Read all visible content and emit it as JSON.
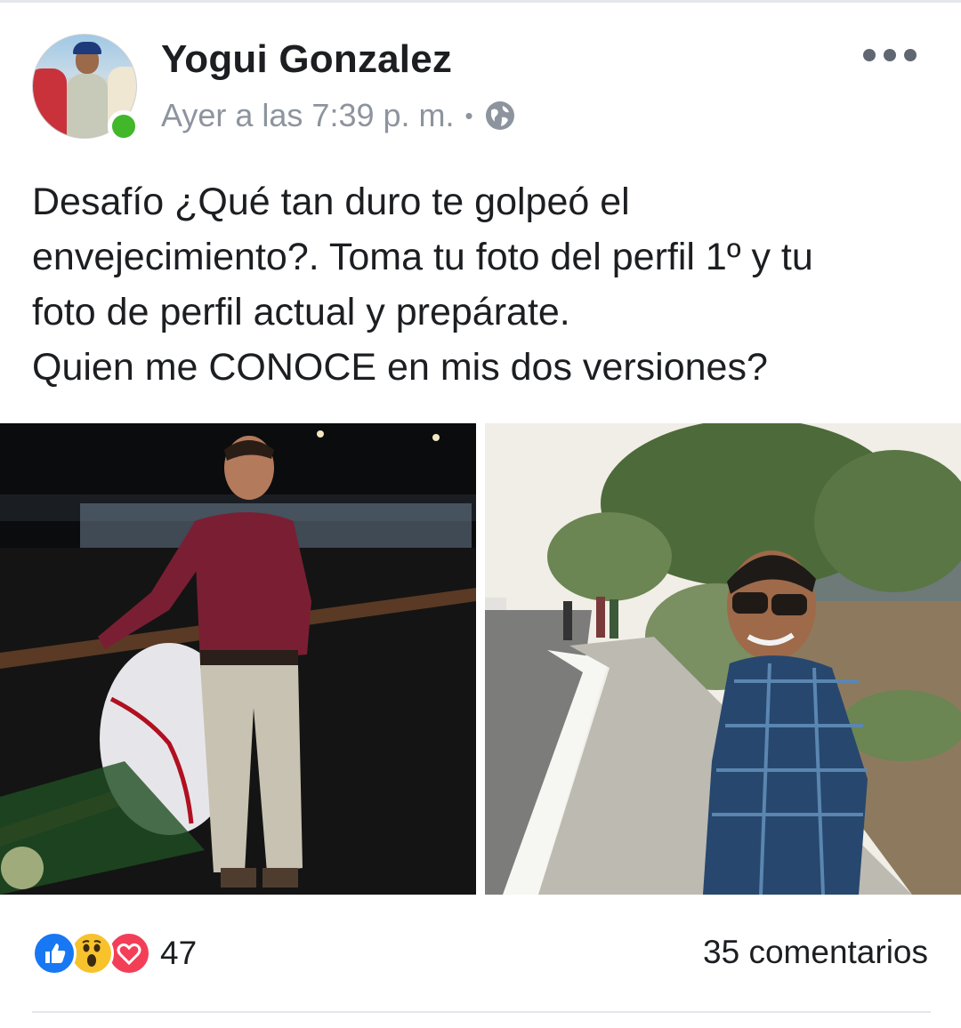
{
  "post": {
    "author": "Yogui Gonzalez",
    "timestamp": "Ayer a las 7:39 p. m.",
    "separator": "•",
    "privacy_icon": "globe-icon",
    "status": "online",
    "text_lines": [
      "Desafío ¿Qué tan duro te golpeó el",
      "envejecimiento?. Toma tu foto del perfil 1º y tu",
      "foto de perfil actual y prepárate.",
      "Quien me CONOCE en mis dos versiones?"
    ]
  },
  "footer": {
    "reaction_icons": [
      "like-icon",
      "wow-icon",
      "love-icon"
    ],
    "reaction_count": "47",
    "comments": "35 comentarios"
  },
  "colors": {
    "like": "#1877f2",
    "wow": "#f7c22b",
    "love": "#f33e58",
    "online": "#42b72a",
    "meta_text": "#8d949e"
  }
}
